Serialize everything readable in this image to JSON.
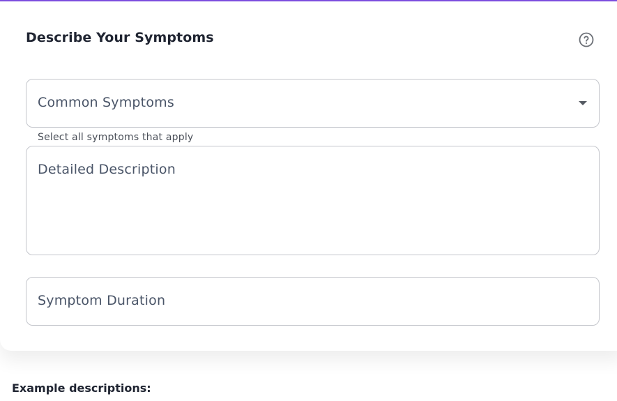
{
  "card": {
    "title": "Describe Your Symptoms",
    "help_icon": "help-circle-icon",
    "accent_color": "#7c4ddf"
  },
  "symptoms_select": {
    "label": "Common Symptoms",
    "helper_text": "Select all symptoms that apply",
    "icon": "chevron-down-icon"
  },
  "description_field": {
    "label": "Detailed Description"
  },
  "duration_field": {
    "label": "Symptom Duration"
  },
  "examples": {
    "heading": "Example descriptions:"
  }
}
